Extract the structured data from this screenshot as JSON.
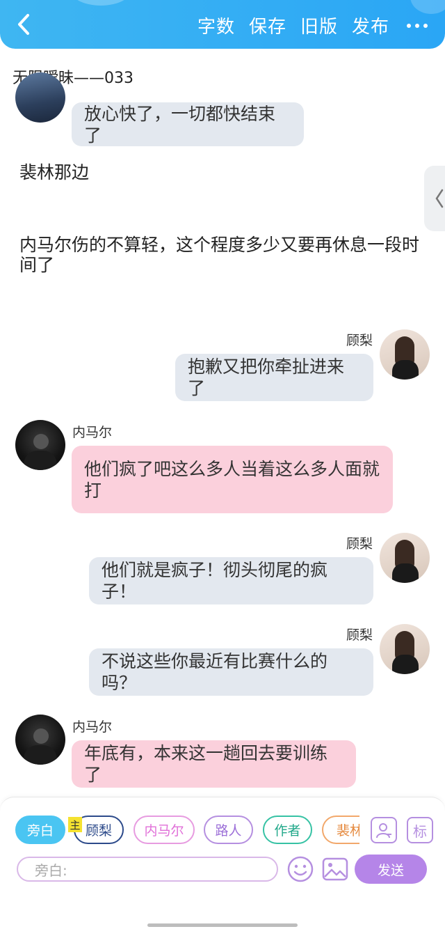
{
  "header": {
    "actions": [
      "字数",
      "保存",
      "旧版",
      "发布"
    ],
    "bg_color": "#2aa6f5"
  },
  "document": {
    "title": "无限暧昧——033"
  },
  "messages": [
    {
      "text": "放心快了，一切都快结束了"
    },
    {
      "speaker": "顾梨",
      "text": "抱歉又把你牵扯进来了"
    },
    {
      "speaker": "内马尔",
      "text": "他们疯了吧这么多人当着这么多人面就打"
    },
    {
      "speaker": "顾梨",
      "text": "他们就是疯子！彻头彻尾的疯子！"
    },
    {
      "speaker": "顾梨",
      "text": "不说这些你最近有比赛什么的吗？"
    },
    {
      "speaker": "内马尔",
      "text": "年底有，本来这一趟回去要训练了"
    }
  ],
  "narrations": [
    "裴林那边",
    "内马尔伤的不算轻，这个程度多少又要再休息一段时间了"
  ],
  "roles": {
    "items": [
      "旁白",
      "顾梨",
      "内马尔",
      "路人",
      "作者",
      "裴林"
    ],
    "main_badge": "主",
    "tag_icon_label": "标"
  },
  "composer": {
    "placeholder": "旁白:",
    "send_label": "发送"
  },
  "colors": {
    "gray_bubble": "#e3e8ef",
    "pink_bubble": "#fbd0dc",
    "accent_purple": "#b585e8"
  }
}
